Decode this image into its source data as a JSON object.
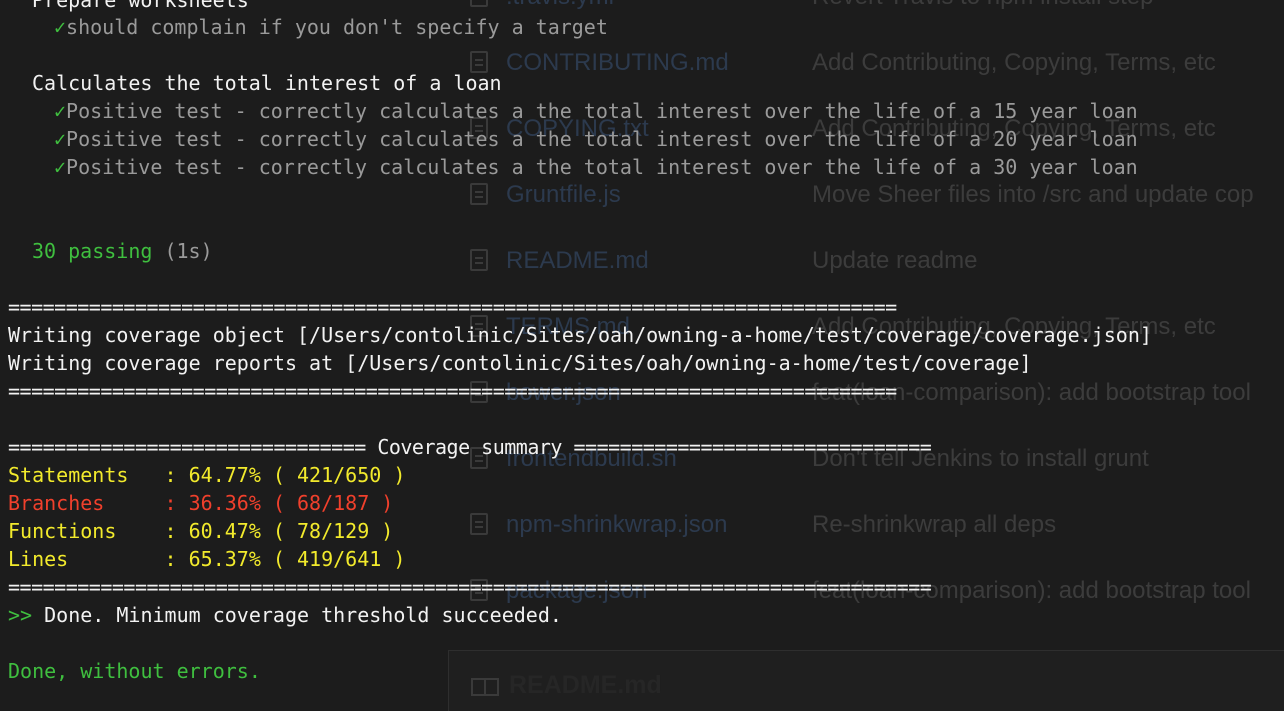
{
  "background_window": {
    "files": [
      {
        "name": ".travis.yml",
        "message": "Revert Travis to npm install step"
      },
      {
        "name": "CONTRIBUTING.md",
        "message": "Add Contributing, Copying, Terms, etc"
      },
      {
        "name": "COPYING.txt",
        "message": "Add Contributing, Copying, Terms, etc"
      },
      {
        "name": "Gruntfile.js",
        "message": "Move Sheer files into /src and update cop"
      },
      {
        "name": "README.md",
        "message": "Update readme"
      },
      {
        "name": "TERMS.md",
        "message": "Add Contributing, Copying, Terms, etc"
      },
      {
        "name": "bower.json",
        "message": "feat(loan-comparison): add bootstrap tool"
      },
      {
        "name": "frontendbuild.sh",
        "message": "Don't tell Jenkins to install grunt"
      },
      {
        "name": "npm-shrinkwrap.json",
        "message": "Re-shrinkwrap all deps"
      },
      {
        "name": "package.json",
        "message": "feat(loan-comparison): add bootstrap tool"
      }
    ],
    "readme_title": "README.md"
  },
  "terminal": {
    "suite1_title": "Prepare worksheets",
    "check_mark": "✓",
    "suite1_tests": [
      "should complain if you don't specify a target"
    ],
    "suite2_title": "Calculates the total interest of a loan",
    "suite2_tests": [
      "Positive test - correctly calculates a the total interest over the life of a 15 year loan",
      "Positive test - correctly calculates a the total interest over the life of a 20 year loan",
      "Positive test - correctly calculates a the total interest over the life of a 30 year loan"
    ],
    "passing_count": "30 passing",
    "passing_time": "(1s)",
    "separator": "=============================================================================",
    "coverage_object_line": "Writing coverage object [/Users/contolinic/Sites/oah/owning-a-home/test/coverage/coverage.json]",
    "coverage_reports_line": "Writing coverage reports at [/Users/contolinic/Sites/oah/owning-a-home/test/coverage]",
    "summary_header": "=============================== Coverage summary ===============================",
    "summary": [
      {
        "label": "Statements   ",
        "value": ": 64.77% ( 421/650 )",
        "status": "warn"
      },
      {
        "label": "Branches     ",
        "value": ": 36.36% ( 68/187 )",
        "status": "fail"
      },
      {
        "label": "Functions    ",
        "value": ": 60.47% ( 78/129 )",
        "status": "warn"
      },
      {
        "label": "Lines        ",
        "value": ": 65.37% ( 419/641 )",
        "status": "warn"
      }
    ],
    "separator_long": "================================================================================",
    "prompt": ">>",
    "threshold_msg": " Done. Minimum coverage threshold succeeded.",
    "done_msg": "Done, without errors."
  },
  "colors": {
    "background": "#1c1c1c",
    "text": "#f2f2f2",
    "pass_green": "#3fbf3f",
    "warn_yellow": "#f2ea2c",
    "fail_red": "#f0402c",
    "dim": "#9a9a9a"
  }
}
